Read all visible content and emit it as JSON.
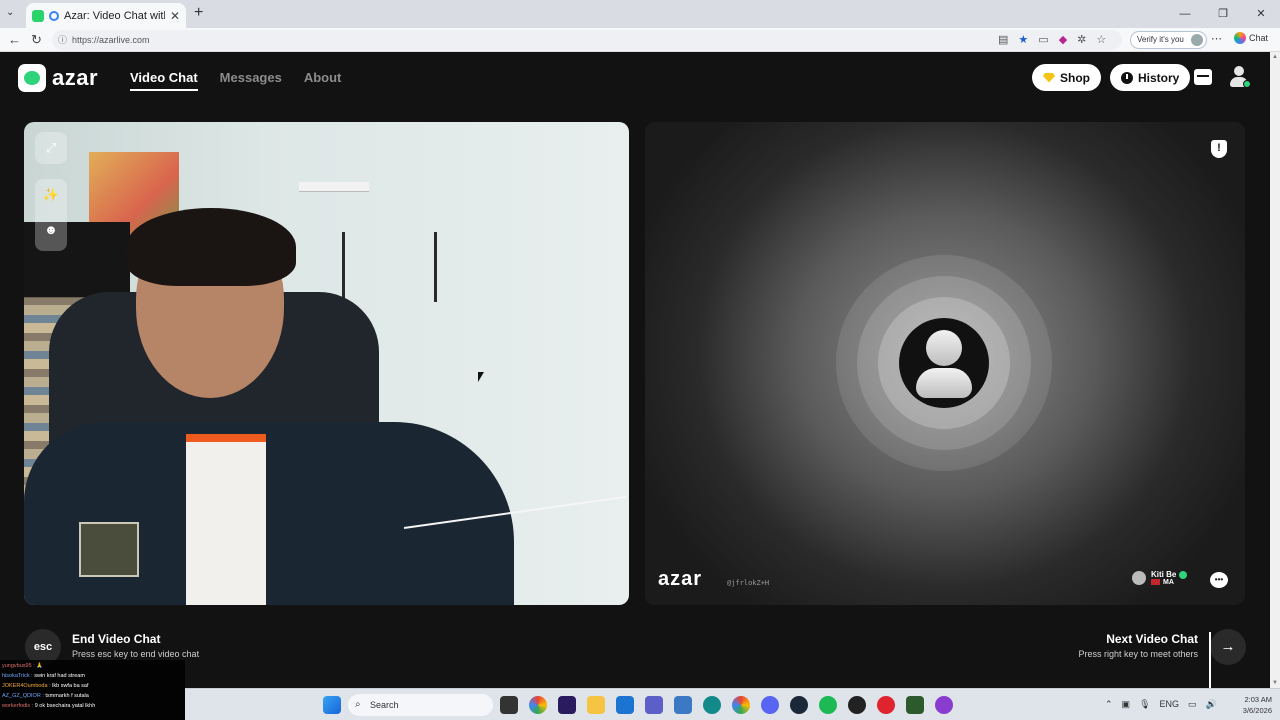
{
  "browser": {
    "tab_title": "Azar: Video Chat with New Pe",
    "tab_close": "✕",
    "new_tab": "+",
    "url": "https://azarlive.com",
    "verify": "Verify it's you",
    "copilot": "Chat",
    "window_controls": [
      "—",
      "❐",
      "✕"
    ]
  },
  "nav": {
    "logo": "azar",
    "links": [
      "Video Chat",
      "Messages",
      "About"
    ],
    "shop": "Shop",
    "history": "History"
  },
  "remote": {
    "logo": "azar",
    "watermark_id": "@jfrlokZ+H",
    "peer_name": "Kiti Be",
    "peer_country": "MA"
  },
  "controls": {
    "esc_key": "esc",
    "end_title": "End Video Chat",
    "end_sub": "Press esc key to end video chat",
    "next_title": "Next Video Chat",
    "next_sub": "Press right key to meet others",
    "next_arrow": "→"
  },
  "stream_chat": [
    {
      "user": "yungvbus95 :",
      "msg": " 🙏"
    },
    {
      "user": "hisokaTrick :",
      "msg": " swin kraf had stream"
    },
    {
      "user": "JOKER4Oumboda :",
      "msg": " lkb swfa ba saf"
    },
    {
      "user": "AZ_GZ_QDIOR :",
      "msg": " tsmmarkh f sutala"
    },
    {
      "user": "workerfodis :",
      "msg": " 9 ok bsechaira yatal lkhh"
    }
  ],
  "taskbar": {
    "search": "Search",
    "lang": "ENG",
    "time": "2:03 AM",
    "date": "3/6/2026"
  },
  "colors": {
    "accent_green": "#2fd37a",
    "page_bg": "#121212",
    "shop_gem": "#f6c416"
  }
}
